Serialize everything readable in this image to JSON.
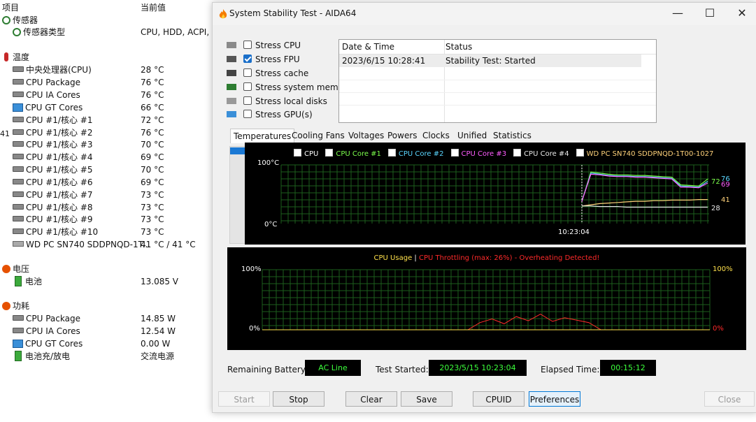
{
  "left_panel": {
    "headers": {
      "item": "项目",
      "value": "当前值"
    },
    "edge_number": "41",
    "rows": [
      {
        "label": "传感器",
        "value": "",
        "indent": 0,
        "icon": "sensor-icon",
        "section": true
      },
      {
        "label": "传感器类型",
        "value": "CPU, HDD, ACPI, SN",
        "indent": 1,
        "icon": "sensor-type-icon"
      },
      {
        "label": "温度",
        "value": "",
        "indent": 0,
        "icon": "thermometer-icon",
        "section": true
      },
      {
        "label": "中央处理器(CPU)",
        "value": "28 °C",
        "indent": 1,
        "icon": "cpu-chip-icon"
      },
      {
        "label": "CPU Package",
        "value": "76 °C",
        "indent": 1,
        "icon": "cpu-chip-icon"
      },
      {
        "label": "CPU IA Cores",
        "value": "76 °C",
        "indent": 1,
        "icon": "cpu-chip-icon"
      },
      {
        "label": "CPU GT Cores",
        "value": "66 °C",
        "indent": 1,
        "icon": "monitor-icon"
      },
      {
        "label": "CPU #1/核心 #1",
        "value": "72 °C",
        "indent": 1,
        "icon": "cpu-chip-icon"
      },
      {
        "label": "CPU #1/核心 #2",
        "value": "76 °C",
        "indent": 1,
        "icon": "cpu-chip-icon"
      },
      {
        "label": "CPU #1/核心 #3",
        "value": "70 °C",
        "indent": 1,
        "icon": "cpu-chip-icon"
      },
      {
        "label": "CPU #1/核心 #4",
        "value": "69 °C",
        "indent": 1,
        "icon": "cpu-chip-icon"
      },
      {
        "label": "CPU #1/核心 #5",
        "value": "70 °C",
        "indent": 1,
        "icon": "cpu-chip-icon"
      },
      {
        "label": "CPU #1/核心 #6",
        "value": "69 °C",
        "indent": 1,
        "icon": "cpu-chip-icon"
      },
      {
        "label": "CPU #1/核心 #7",
        "value": "73 °C",
        "indent": 1,
        "icon": "cpu-chip-icon"
      },
      {
        "label": "CPU #1/核心 #8",
        "value": "73 °C",
        "indent": 1,
        "icon": "cpu-chip-icon"
      },
      {
        "label": "CPU #1/核心 #9",
        "value": "73 °C",
        "indent": 1,
        "icon": "cpu-chip-icon"
      },
      {
        "label": "CPU #1/核心 #10",
        "value": "73 °C",
        "indent": 1,
        "icon": "cpu-chip-icon"
      },
      {
        "label": "WD PC SN740 SDDPNQD-1T...",
        "value": "41 °C / 41 °C",
        "indent": 1,
        "icon": "disk-icon"
      },
      {
        "label": "电压",
        "value": "",
        "indent": 0,
        "icon": "voltage-icon",
        "section": true
      },
      {
        "label": "电池",
        "value": "13.085 V",
        "indent": 1,
        "icon": "battery-icon"
      },
      {
        "label": "功耗",
        "value": "",
        "indent": 0,
        "icon": "power-icon",
        "section": true
      },
      {
        "label": "CPU Package",
        "value": "14.85 W",
        "indent": 1,
        "icon": "cpu-chip-icon"
      },
      {
        "label": "CPU IA Cores",
        "value": "12.54 W",
        "indent": 1,
        "icon": "cpu-chip-icon"
      },
      {
        "label": "CPU GT Cores",
        "value": "0.00 W",
        "indent": 1,
        "icon": "monitor-icon"
      },
      {
        "label": "电池充/放电",
        "value": "交流电源",
        "indent": 1,
        "icon": "battery-icon"
      }
    ]
  },
  "window": {
    "title": "System Stability Test - AIDA64",
    "controls": {
      "minimize": "—",
      "maximize": "☐",
      "close": "✕"
    },
    "stress_options": [
      {
        "label": "Stress CPU",
        "checked": false,
        "icon": "cpu-stress-icon"
      },
      {
        "label": "Stress FPU",
        "checked": true,
        "icon": "fpu-stress-icon"
      },
      {
        "label": "Stress cache",
        "checked": false,
        "icon": "cache-stress-icon"
      },
      {
        "label": "Stress system memory",
        "checked": false,
        "icon": "memory-stress-icon"
      },
      {
        "label": "Stress local disks",
        "checked": false,
        "icon": "disk-stress-icon"
      },
      {
        "label": "Stress GPU(s)",
        "checked": false,
        "icon": "gpu-stress-icon"
      }
    ],
    "log": {
      "columns": [
        "Date & Time",
        "Status"
      ],
      "rows": [
        [
          "2023/6/15 10:28:41",
          "Stability Test: Started"
        ]
      ]
    },
    "tabs": [
      "Temperatures",
      "Cooling Fans",
      "Voltages",
      "Powers",
      "Clocks",
      "Unified",
      "Statistics"
    ],
    "active_tab": "Temperatures",
    "temp_legend": [
      {
        "label": "CPU",
        "color": "#ffffff"
      },
      {
        "label": "CPU Core #1",
        "color": "#7cff4c"
      },
      {
        "label": "CPU Core #2",
        "color": "#5ad6ff"
      },
      {
        "label": "CPU Core #3",
        "color": "#ff5cff"
      },
      {
        "label": "CPU Core #4",
        "color": "#e8e8e8"
      },
      {
        "label": "WD PC SN740 SDDPNQD-1T00-1027",
        "color": "#ffd27a"
      }
    ],
    "temp_axis": {
      "top": "100°C",
      "bottom": "0°C",
      "time": "10:23:04"
    },
    "temp_readouts": [
      "76",
      "72",
      "69",
      "41",
      "28"
    ],
    "usage_title": {
      "usage": "CPU Usage",
      "separator": "|",
      "throttling": "CPU Throttling (max: 26%) - Overheating Detected!"
    },
    "usage_axis": {
      "left_top": "100%",
      "left_bottom": "0%",
      "right_top": "100%",
      "right_bottom": "0%"
    },
    "status": {
      "battery_label": "Remaining Battery:",
      "battery_value": "AC Line",
      "started_label": "Test Started:",
      "started_value": "2023/5/15 10:23:04",
      "elapsed_label": "Elapsed Time:",
      "elapsed_value": "00:15:12"
    },
    "buttons": {
      "start": "Start",
      "stop": "Stop",
      "clear": "Clear",
      "save": "Save",
      "cpuid": "CPUID",
      "preferences": "Preferences",
      "close": "Close"
    }
  },
  "chart_data": [
    {
      "type": "line",
      "title": "",
      "x": [
        "10:23:04"
      ],
      "ylim": [
        0,
        100
      ],
      "legend": [
        "CPU",
        "CPU Core #1",
        "CPU Core #2",
        "CPU Core #3",
        "CPU Core #4",
        "WD PC SN740 SDDPNQD-1T00-1027"
      ],
      "current_values": {
        "CPU": 28,
        "CPU Core #1": 76,
        "CPU Core #2": 72,
        "CPU Core #3": 69,
        "CPU Core #4": 72,
        "WD PC SN740 SDDPNQD-1T00-1027": 41
      },
      "series": [
        {
          "name": "CPU Core #1",
          "values": [
            38,
            88,
            86,
            84,
            83,
            83,
            82,
            82,
            81,
            80,
            79,
            66,
            65,
            64,
            76
          ]
        },
        {
          "name": "CPU Core #2",
          "values": [
            38,
            86,
            84,
            82,
            81,
            81,
            80,
            80,
            79,
            78,
            77,
            64,
            63,
            62,
            72
          ]
        },
        {
          "name": "CPU Core #3",
          "values": [
            38,
            84,
            83,
            81,
            80,
            80,
            79,
            79,
            78,
            77,
            76,
            62,
            62,
            61,
            69
          ]
        },
        {
          "name": "WD PC SN740 SDDPNQD-1T00-1027",
          "values": [
            30,
            32,
            34,
            35,
            36,
            37,
            38,
            38,
            39,
            39,
            40,
            40,
            40,
            41,
            41
          ]
        },
        {
          "name": "CPU",
          "values": [
            30,
            30,
            29,
            29,
            29,
            28,
            28,
            28,
            28,
            28,
            28,
            28,
            28,
            28,
            28
          ]
        }
      ]
    },
    {
      "type": "line",
      "title": "CPU Usage | CPU Throttling (max: 26%) - Overheating Detected!",
      "ylim": [
        0,
        100
      ],
      "series": [
        {
          "name": "CPU Throttling",
          "values": [
            0,
            0,
            0,
            0,
            0,
            0,
            0,
            0,
            0,
            0,
            0,
            0,
            0,
            0,
            0,
            0,
            0,
            0,
            12,
            18,
            10,
            22,
            15,
            26,
            14,
            20,
            16,
            12,
            0,
            0,
            0,
            0,
            0,
            0,
            0,
            0,
            0,
            0
          ]
        }
      ]
    }
  ]
}
